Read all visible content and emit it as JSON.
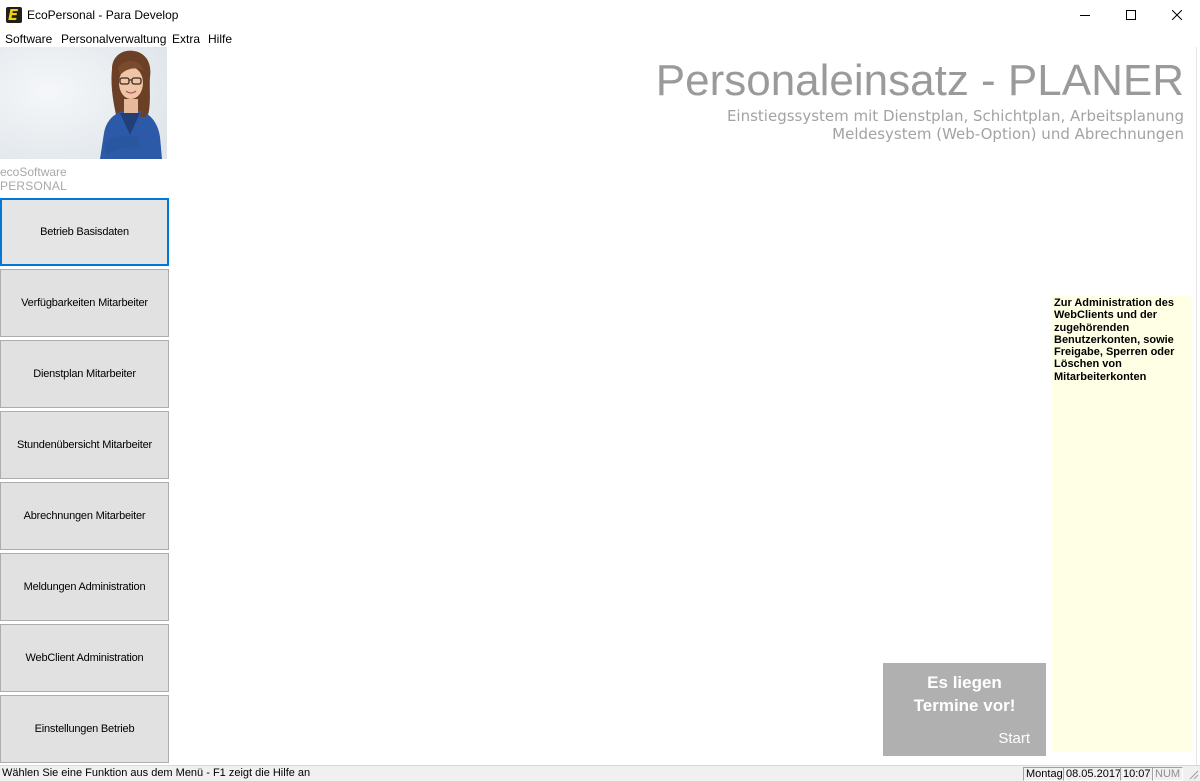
{
  "window": {
    "title": "EcoPersonal - Para Develop",
    "app_icon_letter": "E",
    "minimize_icon": "minimize-icon",
    "maximize_icon": "maximize-icon",
    "close_icon": "close-icon"
  },
  "menu": [
    {
      "label": "Software"
    },
    {
      "label": "Personalverwaltung"
    },
    {
      "label": "Extra"
    },
    {
      "label": "Hilfe"
    }
  ],
  "brand": {
    "line1": "ecoSoftware",
    "line2": "PERSONAL"
  },
  "nav": [
    {
      "label": "Betrieb Basisdaten",
      "active": true
    },
    {
      "label": "Verfügbarkeiten Mitarbeiter"
    },
    {
      "label": "Dienstplan Mitarbeiter"
    },
    {
      "label": "Stundenübersicht Mitarbeiter"
    },
    {
      "label": "Abrechnungen Mitarbeiter"
    },
    {
      "label": "Meldungen Administration"
    },
    {
      "label": "WebClient Administration"
    },
    {
      "label": "Einstellungen Betrieb"
    }
  ],
  "header": {
    "title": "Personaleinsatz - PLANER",
    "subtitle_line1": "Einstiegssystem mit Dienstplan, Schichtplan, Arbeitsplanung",
    "subtitle_line2": "Meldesystem (Web-Option) und Abrechnungen"
  },
  "info_panel": {
    "text": "Zur Administration des WebClients und der zugehörenden Benutzerkonten, sowie Freigabe, Sperren oder Löschen von Mitarbeiterkonten"
  },
  "termine_tile": {
    "line1": "Es liegen",
    "line2": "Termine vor!",
    "start": "Start"
  },
  "statusbar": {
    "hint": "Wählen Sie eine Funktion aus dem Menü - F1 zeigt die Hilfe an",
    "day": "Montag",
    "date": "08.05.2017",
    "time": "10:07",
    "num": "NUM"
  },
  "colors": {
    "accent_border": "#0078d7",
    "tile_gray": "#b0b0b0",
    "info_bg": "#ffffe6",
    "hero_text": "#9a9a9a"
  }
}
